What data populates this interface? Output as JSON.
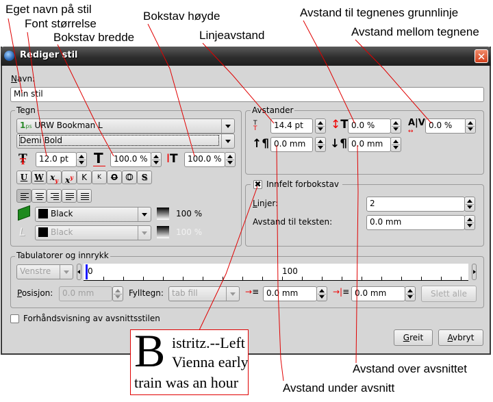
{
  "annotations": {
    "eget_navn": "Eget navn på stil",
    "font_storrelse": "Font størrelse",
    "bokstav_bredde": "Bokstav bredde",
    "bokstav_hoyde": "Bokstav høyde",
    "linjeavstand": "Linjeavstand",
    "grunnlinje": "Avstand til tegnenes grunnlinje",
    "mellom_tegnene": "Avstand mellom tegnene",
    "over_avsnittet": "Avstand over avsnittet",
    "under_avsnitt": "Avstand under avsnitt"
  },
  "dialog": {
    "title": "Rediger stil",
    "close_icon": "close-icon",
    "name_label": "Navn:",
    "name_value": "Min stil"
  },
  "tegn": {
    "title": "Tegn",
    "font": "URW Bookman L",
    "font_type_icon": "ps",
    "style": "Demi Bold",
    "font_size": "12.0 pt",
    "char_width": "100.0 %",
    "char_height": "100.0 %",
    "format_buttons": [
      "underline",
      "word-underline",
      "subscript",
      "superscript",
      "all-caps",
      "small-caps",
      "strikethrough",
      "outline",
      "shadow"
    ],
    "align_buttons": [
      "left",
      "center",
      "right",
      "justify",
      "force-justify"
    ],
    "fill_color": "Black",
    "fill_shade": "100 %",
    "stroke_color": "Black",
    "stroke_shade": "100 %"
  },
  "avstander": {
    "title": "Avstander",
    "line_spacing": "14.4 pt",
    "baseline_offset": "0.0 %",
    "tracking": "0.0 %",
    "space_above": "0.0 mm",
    "space_below": "0.0 mm"
  },
  "dropcap": {
    "title": "Innfelt forbokstav",
    "checked": true,
    "check_mark": "✖",
    "lines_label": "Linjer:",
    "lines_value": "2",
    "distance_label": "Avstand til teksten:",
    "distance_value": "0.0 mm"
  },
  "tabs": {
    "title": "Tabulatorer og innrykk",
    "alignment": "Venstre",
    "ruler_start": "0",
    "ruler_mid": "100",
    "position_label": "Posisjon:",
    "position_value": "0.0 mm",
    "fill_label": "Fylltegn:",
    "fill_value": "tab fill",
    "first_indent": "0.0 mm",
    "left_indent": "0.0 mm",
    "delete_all": "Slett alle"
  },
  "preview_checkbox": "Forhåndsvisning av avsnittsstilen",
  "buttons": {
    "ok": "Greit",
    "cancel": "Avbryt"
  },
  "preview": {
    "dropcap": "B",
    "line1": "istritz.--Left",
    "line2": "Vienna early",
    "line3": "train was an hour"
  }
}
